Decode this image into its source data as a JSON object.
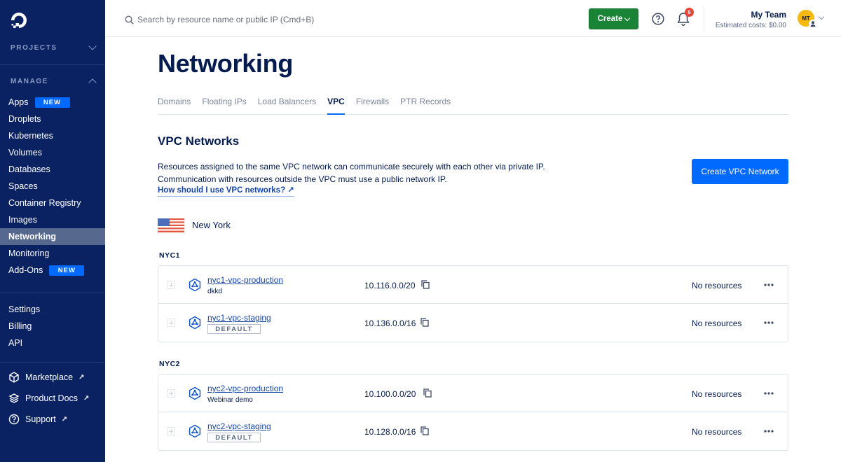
{
  "sidebar": {
    "projects_label": "PROJECTS",
    "manage_label": "MANAGE",
    "items": [
      {
        "label": "Apps",
        "badge": "NEW"
      },
      {
        "label": "Droplets"
      },
      {
        "label": "Kubernetes"
      },
      {
        "label": "Volumes"
      },
      {
        "label": "Databases"
      },
      {
        "label": "Spaces"
      },
      {
        "label": "Container Registry"
      },
      {
        "label": "Images"
      },
      {
        "label": "Networking",
        "active": true
      },
      {
        "label": "Monitoring"
      },
      {
        "label": "Add-Ons",
        "badge": "NEW"
      }
    ],
    "account_items": [
      {
        "label": "Settings"
      },
      {
        "label": "Billing"
      },
      {
        "label": "API"
      }
    ],
    "external_items": [
      {
        "label": "Marketplace",
        "icon": "marketplace-icon"
      },
      {
        "label": "Product Docs",
        "icon": "docs-icon"
      },
      {
        "label": "Support",
        "icon": "help-icon"
      }
    ]
  },
  "topbar": {
    "search_placeholder": "Search by resource name or public IP (Cmd+B)",
    "create_label": "Create",
    "notification_count": "5",
    "team_name": "My Team",
    "estimated_costs": "Estimated costs: $0.00",
    "avatar_initials": "MT"
  },
  "main": {
    "title": "Networking",
    "tabs": [
      {
        "label": "Domains"
      },
      {
        "label": "Floating IPs"
      },
      {
        "label": "Load Balancers"
      },
      {
        "label": "VPC",
        "active": true
      },
      {
        "label": "Firewalls"
      },
      {
        "label": "PTR Records"
      }
    ],
    "section_title": "VPC Networks",
    "description_line1": "Resources assigned to the same VPC network can communicate securely with each other via private IP.",
    "description_line2": "Communication with resources outside the VPC must use a public network IP.",
    "help_link": "How should I use VPC networks? ↗",
    "create_vpc_label": "Create VPC Network",
    "region": {
      "name": "New York",
      "flag": "us-flag"
    },
    "datacenters": [
      {
        "label": "NYC1",
        "vpcs": [
          {
            "name": "nyc1-vpc-production",
            "description": "dkkd",
            "default": false,
            "ip_range": "10.116.0.0/20",
            "resources": "No resources"
          },
          {
            "name": "nyc1-vpc-staging",
            "default": true,
            "default_label": "DEFAULT",
            "ip_range": "10.136.0.0/16",
            "resources": "No resources"
          }
        ]
      },
      {
        "label": "NYC2",
        "vpcs": [
          {
            "name": "nyc2-vpc-production",
            "description": "Webinar demo",
            "default": false,
            "ip_range": "10.100.0.0/20",
            "resources": "No resources"
          },
          {
            "name": "nyc2-vpc-staging",
            "default": true,
            "default_label": "DEFAULT",
            "ip_range": "10.128.0.0/16",
            "resources": "No resources"
          }
        ]
      }
    ]
  },
  "colors": {
    "sidebar_bg": "#0b2262",
    "accent": "#0069ff",
    "create_green": "#1a8436",
    "text_dark": "#031b4e"
  }
}
